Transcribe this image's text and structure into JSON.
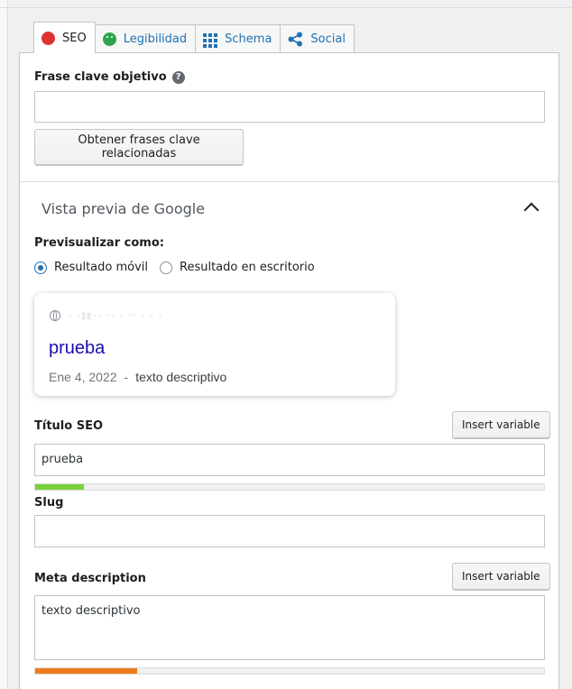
{
  "tabs": [
    {
      "label": "SEO",
      "icon": "red-dot-icon"
    },
    {
      "label": "Legibilidad",
      "icon": "smiley-icon"
    },
    {
      "label": "Schema",
      "icon": "grid-icon"
    },
    {
      "label": "Social",
      "icon": "share-icon"
    }
  ],
  "keyphrase": {
    "label": "Frase clave objetivo",
    "help_glyph": "?",
    "value": "",
    "related_button": "Obtener frases clave relacionadas"
  },
  "google_preview": {
    "heading": "Vista previa de Google",
    "preview_as_label": "Previsualizar como:",
    "options": [
      {
        "label": "Resultado móvil",
        "selected": true
      },
      {
        "label": "Resultado en escritorio",
        "selected": false
      }
    ],
    "serp": {
      "url_blurred": "· ·ɪɛ·· ·· ·   ·· · ·   ·",
      "title": "prueba",
      "date": "Ene 4, 2022",
      "separator": "-",
      "description": "texto descriptivo"
    }
  },
  "seo_title": {
    "label": "Título SEO",
    "insert_button": "Insert variable",
    "value": "prueba",
    "progress": 0.095,
    "progress_color": "#7ad03a"
  },
  "slug": {
    "label": "Slug",
    "value": ""
  },
  "meta_description": {
    "label": "Meta description",
    "insert_button": "Insert variable",
    "value": "texto descriptivo",
    "progress": 0.2,
    "progress_color": "#ee7c1b"
  }
}
